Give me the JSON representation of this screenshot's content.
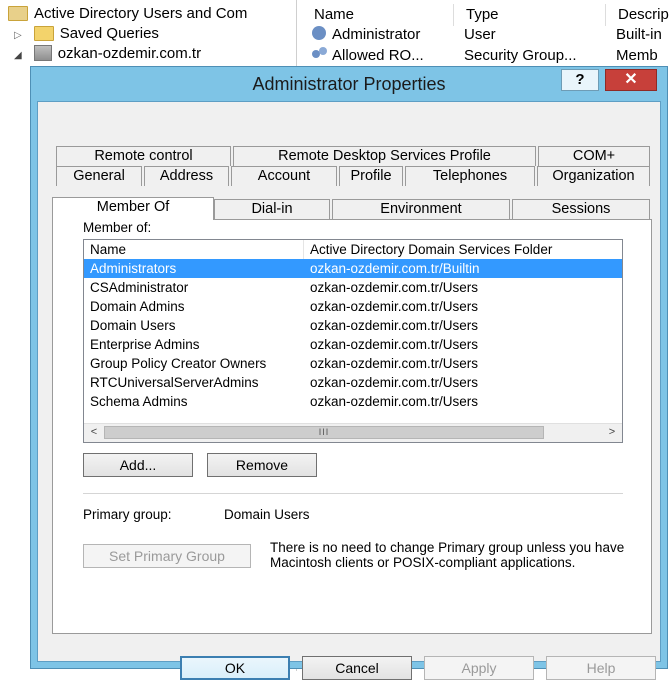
{
  "tree": {
    "root_label": "Active Directory Users and Com",
    "items": [
      {
        "label": "Saved Queries"
      },
      {
        "label": "ozkan-ozdemir.com.tr"
      }
    ]
  },
  "list": {
    "columns": [
      "Name",
      "Type",
      "Descrip"
    ],
    "rows": [
      {
        "name": "Administrator",
        "type": "User",
        "desc": "Built-in"
      },
      {
        "name": "Allowed RO...",
        "type": "Security Group...",
        "desc": "Memb"
      }
    ]
  },
  "dialog": {
    "title": "Administrator Properties",
    "help_label": "?",
    "close_label": "✕",
    "tabs_row1": [
      "Remote control",
      "Remote Desktop Services Profile",
      "COM+"
    ],
    "tabs_row2": [
      "General",
      "Address",
      "Account",
      "Profile",
      "Telephones",
      "Organization"
    ],
    "tabs_row3": [
      "Member Of",
      "Dial-in",
      "Environment",
      "Sessions"
    ],
    "member_of_label": "Member of:",
    "columns": [
      "Name",
      "Active Directory Domain Services Folder"
    ],
    "groups": [
      {
        "name": "Administrators",
        "folder": "ozkan-ozdemir.com.tr/Builtin"
      },
      {
        "name": "CSAdministrator",
        "folder": "ozkan-ozdemir.com.tr/Users"
      },
      {
        "name": "Domain Admins",
        "folder": "ozkan-ozdemir.com.tr/Users"
      },
      {
        "name": "Domain Users",
        "folder": "ozkan-ozdemir.com.tr/Users"
      },
      {
        "name": "Enterprise Admins",
        "folder": "ozkan-ozdemir.com.tr/Users"
      },
      {
        "name": "Group Policy Creator Owners",
        "folder": "ozkan-ozdemir.com.tr/Users"
      },
      {
        "name": "RTCUniversalServerAdmins",
        "folder": "ozkan-ozdemir.com.tr/Users"
      },
      {
        "name": "Schema Admins",
        "folder": "ozkan-ozdemir.com.tr/Users"
      }
    ],
    "scroll_left": "<",
    "scroll_right": ">",
    "scroll_grip": "III",
    "add_label": "Add...",
    "remove_label": "Remove",
    "primary_group_label": "Primary group:",
    "primary_group_value": "Domain Users",
    "set_primary_label": "Set Primary Group",
    "note_text": "There is no need to change Primary group unless you have Macintosh clients or POSIX-compliant applications.",
    "ok_label": "OK",
    "cancel_label": "Cancel",
    "apply_label": "Apply",
    "help_button_label": "Help"
  },
  "colors": {
    "dialog_frame": "#7ec4e6",
    "selection": "#3399ff",
    "close_button": "#c7403a"
  }
}
